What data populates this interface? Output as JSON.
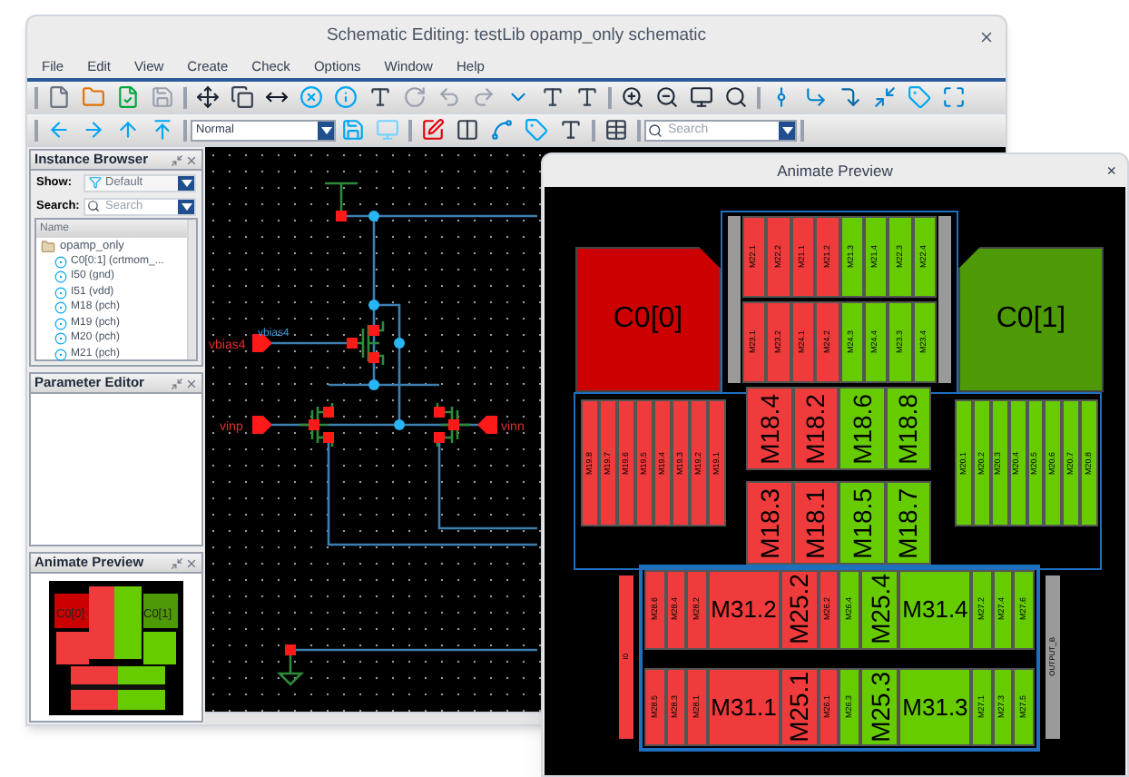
{
  "window": {
    "title": "Schematic Editing: testLib opamp_only schematic"
  },
  "menu": [
    "File",
    "Edit",
    "View",
    "Create",
    "Check",
    "Options",
    "Window",
    "Help"
  ],
  "toolbar": {
    "mode": "Normal",
    "search": {
      "placeholder": "Search"
    }
  },
  "instance_browser": {
    "title": "Instance Browser",
    "show_label": "Show:",
    "show_value": "Default",
    "search_label": "Search:",
    "search": {
      "placeholder": "Search"
    },
    "column": "Name",
    "tree": [
      {
        "label": "opamp_only",
        "expanded": true,
        "children": [
          {
            "label": "C0[0:1] (crtmom_..."
          },
          {
            "label": "I50 (gnd)"
          },
          {
            "label": "I51 (vdd)"
          },
          {
            "label": "M18 (pch)"
          },
          {
            "label": "M19 (pch)"
          },
          {
            "label": "M20 (pch)"
          },
          {
            "label": "M21 (pch)"
          }
        ]
      }
    ]
  },
  "parameter_editor": {
    "title": "Parameter Editor"
  },
  "animate_panel": {
    "title": "Animate Preview",
    "labels": [
      "C0[0]",
      "C0[1]"
    ]
  },
  "schematic": {
    "pins": [
      "vbias4",
      "vinp",
      "vinn"
    ],
    "net_label": "vbias4"
  },
  "animate_preview": {
    "title": "Animate Preview",
    "close": "×",
    "capacitors": [
      {
        "label": "C0[0]",
        "color": "#cc0000"
      },
      {
        "label": "C0[1]",
        "color": "#4e9a06"
      }
    ],
    "top_array": [
      [
        {
          "label": "M22.1",
          "color": "#ef3b3b",
          "kind": "small"
        },
        {
          "label": "M22.2",
          "color": "#ef3b3b",
          "kind": "small"
        },
        {
          "label": "M21.1",
          "color": "#ef3b3b",
          "kind": "small"
        },
        {
          "label": "M21.2",
          "color": "#ef3b3b",
          "kind": "small"
        },
        {
          "label": "M21.3",
          "color": "#66cc00",
          "kind": "small"
        },
        {
          "label": "M21.4",
          "color": "#66cc00",
          "kind": "small"
        },
        {
          "label": "M22.3",
          "color": "#66cc00",
          "kind": "small"
        },
        {
          "label": "M22.4",
          "color": "#66cc00",
          "kind": "small"
        }
      ],
      [
        {
          "label": "M23.1",
          "color": "#ef3b3b",
          "kind": "small"
        },
        {
          "label": "M23.2",
          "color": "#ef3b3b",
          "kind": "small"
        },
        {
          "label": "M24.1",
          "color": "#ef3b3b",
          "kind": "small"
        },
        {
          "label": "M24.2",
          "color": "#ef3b3b",
          "kind": "small"
        },
        {
          "label": "M24.3",
          "color": "#66cc00",
          "kind": "small"
        },
        {
          "label": "M24.4",
          "color": "#66cc00",
          "kind": "small"
        },
        {
          "label": "M23.3",
          "color": "#66cc00",
          "kind": "small"
        },
        {
          "label": "M23.4",
          "color": "#66cc00",
          "kind": "small"
        }
      ]
    ],
    "left_group": [
      {
        "label": "M19.8",
        "color": "#ef3b3b",
        "kind": "small"
      },
      {
        "label": "M19.7",
        "color": "#ef3b3b",
        "kind": "small"
      },
      {
        "label": "M19.6",
        "color": "#ef3b3b",
        "kind": "small"
      },
      {
        "label": "M19.5",
        "color": "#ef3b3b",
        "kind": "small"
      },
      {
        "label": "M19.4",
        "color": "#ef3b3b",
        "kind": "small"
      },
      {
        "label": "M19.3",
        "color": "#ef3b3b",
        "kind": "small"
      },
      {
        "label": "M19.2",
        "color": "#ef3b3b",
        "kind": "small"
      },
      {
        "label": "M19.1",
        "color": "#ef3b3b",
        "kind": "small"
      }
    ],
    "center_group": [
      [
        {
          "label": "M18.4",
          "color": "#ef3b3b",
          "kind": "large"
        },
        {
          "label": "M18.2",
          "color": "#ef3b3b",
          "kind": "large"
        },
        {
          "label": "M18.6",
          "color": "#66cc00",
          "kind": "large"
        },
        {
          "label": "M18.8",
          "color": "#66cc00",
          "kind": "large"
        }
      ],
      [
        {
          "label": "M18.3",
          "color": "#ef3b3b",
          "kind": "large"
        },
        {
          "label": "M18.1",
          "color": "#ef3b3b",
          "kind": "large"
        },
        {
          "label": "M18.5",
          "color": "#66cc00",
          "kind": "large"
        },
        {
          "label": "M18.7",
          "color": "#66cc00",
          "kind": "large"
        }
      ]
    ],
    "right_group": [
      {
        "label": "M20.1",
        "color": "#66cc00",
        "kind": "small"
      },
      {
        "label": "M20.2",
        "color": "#66cc00",
        "kind": "small"
      },
      {
        "label": "M20.3",
        "color": "#66cc00",
        "kind": "small"
      },
      {
        "label": "M20.4",
        "color": "#66cc00",
        "kind": "small"
      },
      {
        "label": "M20.5",
        "color": "#66cc00",
        "kind": "small"
      },
      {
        "label": "M20.6",
        "color": "#66cc00",
        "kind": "small"
      },
      {
        "label": "M20.7",
        "color": "#66cc00",
        "kind": "small"
      },
      {
        "label": "M20.8",
        "color": "#66cc00",
        "kind": "small"
      }
    ],
    "bottom_array": [
      [
        {
          "label": "M28.6",
          "color": "#ef3b3b",
          "kind": "small"
        },
        {
          "label": "M28.4",
          "color": "#ef3b3b",
          "kind": "small"
        },
        {
          "label": "M28.2",
          "color": "#ef3b3b",
          "kind": "small"
        },
        {
          "label": "M31.2",
          "color": "#ef3b3b",
          "kind": "wide"
        },
        {
          "label": "M25.2",
          "color": "#ef3b3b",
          "kind": "large"
        },
        {
          "label": "M26.2",
          "color": "#ef3b3b",
          "kind": "small"
        },
        {
          "label": "M26.4",
          "color": "#66cc00",
          "kind": "small"
        },
        {
          "label": "M25.4",
          "color": "#66cc00",
          "kind": "large"
        },
        {
          "label": "M31.4",
          "color": "#66cc00",
          "kind": "wide"
        },
        {
          "label": "M27.2",
          "color": "#66cc00",
          "kind": "small"
        },
        {
          "label": "M27.4",
          "color": "#66cc00",
          "kind": "small"
        },
        {
          "label": "M27.6",
          "color": "#66cc00",
          "kind": "small"
        }
      ],
      [
        {
          "label": "M28.5",
          "color": "#ef3b3b",
          "kind": "small"
        },
        {
          "label": "M28.3",
          "color": "#ef3b3b",
          "kind": "small"
        },
        {
          "label": "M28.1",
          "color": "#ef3b3b",
          "kind": "small"
        },
        {
          "label": "M31.1",
          "color": "#ef3b3b",
          "kind": "wide"
        },
        {
          "label": "M25.1",
          "color": "#ef3b3b",
          "kind": "large"
        },
        {
          "label": "M26.1",
          "color": "#ef3b3b",
          "kind": "small"
        },
        {
          "label": "M26.3",
          "color": "#66cc00",
          "kind": "small"
        },
        {
          "label": "M25.3",
          "color": "#66cc00",
          "kind": "large"
        },
        {
          "label": "M31.3",
          "color": "#66cc00",
          "kind": "wide"
        },
        {
          "label": "M27.1",
          "color": "#66cc00",
          "kind": "small"
        },
        {
          "label": "M27.3",
          "color": "#66cc00",
          "kind": "small"
        },
        {
          "label": "M27.5",
          "color": "#66cc00",
          "kind": "small"
        }
      ]
    ],
    "side_strips": [
      {
        "label": "I0",
        "color": "#ef3b3b"
      },
      {
        "label": "OUTPUT_B",
        "color": "#9a9a9a"
      }
    ]
  }
}
